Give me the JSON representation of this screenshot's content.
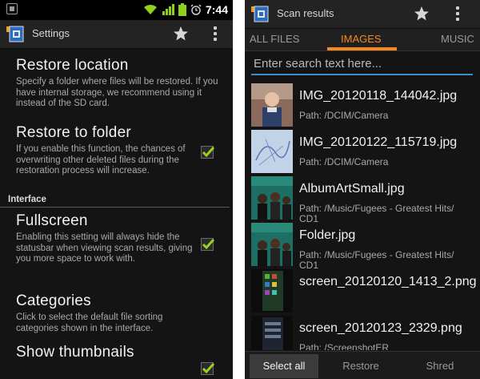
{
  "left": {
    "statusbar": {
      "clock": "7:44"
    },
    "actionbar": {
      "title": "Settings"
    },
    "prefs": [
      {
        "title": "Restore location",
        "summary": "Specify a folder where files will be restored. If you have internal storage, we recommend using it instead of the SD card.",
        "checkbox": null
      },
      {
        "title": "Restore to folder",
        "summary": "If you enable this function, the chances of overwriting other deleted files during the restoration process will increase.",
        "checkbox": true
      }
    ],
    "category": "Interface",
    "prefs2": [
      {
        "title": "Fullscreen",
        "summary": "Enabling this setting will always hide the statusbar when viewing scan results, giving you more space to work with.",
        "checkbox": true
      },
      {
        "title": "Categories",
        "summary": "Click to select the default file sorting categories shown in the interface.",
        "checkbox": null
      },
      {
        "title": "Show thumbnails",
        "summary": "",
        "checkbox": true
      }
    ]
  },
  "right": {
    "actionbar": {
      "title": "Scan results"
    },
    "tabs": [
      "ALL FILES",
      "IMAGES",
      "MUSIC"
    ],
    "active_tab": "IMAGES",
    "search": {
      "placeholder": "Enter search text here..."
    },
    "files": [
      {
        "name": "IMG_20120118_144042.jpg",
        "path": "Path: /DCIM/Camera",
        "thumb": "portrait-photo"
      },
      {
        "name": "IMG_20120122_115719.jpg",
        "path": "Path: /DCIM/Camera",
        "thumb": "blue-sketch-photo"
      },
      {
        "name": "AlbumArtSmall.jpg",
        "path": "Path: /Music/Fugees - Greatest Hits/ CD1",
        "thumb": "album-cover"
      },
      {
        "name": "Folder.jpg",
        "path": "Path: /Music/Fugees - Greatest Hits/ CD1",
        "thumb": "album-cover"
      },
      {
        "name": "screen_20120120_1413_2.png",
        "path": "",
        "thumb": "phone-screenshot"
      },
      {
        "name": "screen_20120123_2329.png",
        "path": "Path: /ScreenshotER",
        "thumb": "phone-screenshot"
      }
    ],
    "bottom": {
      "select_all": "Select all",
      "restore": "Restore",
      "shred": "Shred"
    }
  },
  "colors": {
    "accent": "#f28a21",
    "search_line": "#3a8fcb",
    "check": "#9bd21e",
    "background": "#141414"
  }
}
